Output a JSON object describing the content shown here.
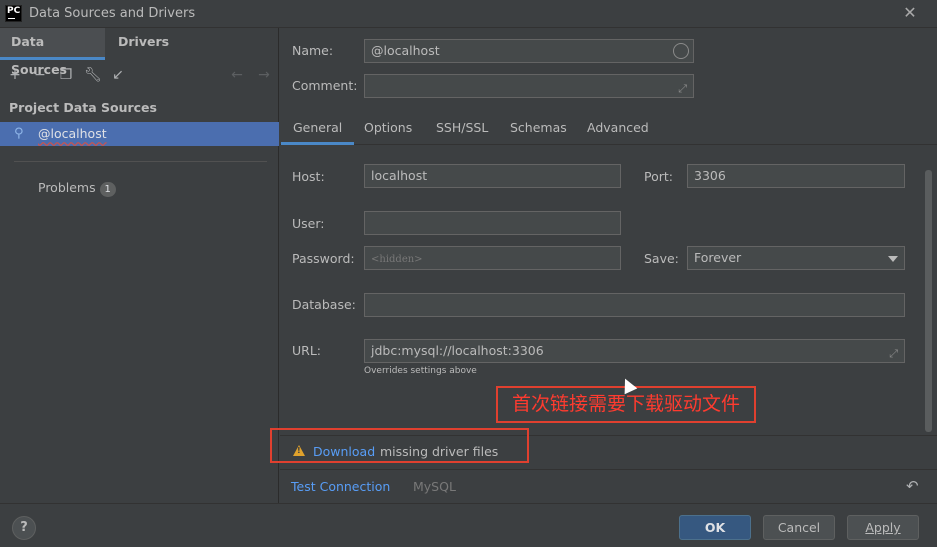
{
  "window": {
    "title": "Data Sources and Drivers",
    "app_logo": "PC"
  },
  "left": {
    "tabs": [
      {
        "label": "Data Sources"
      },
      {
        "label": "Drivers"
      }
    ],
    "toolbar": [
      "add-icon",
      "remove-icon",
      "duplicate-icon",
      "settings-wrench-icon",
      "import-icon",
      "back-arrow-icon",
      "forward-arrow-icon"
    ],
    "section_title": "Project Data Sources",
    "data_sources": [
      {
        "label": "@localhost"
      }
    ],
    "problems": {
      "label": "Problems",
      "count": "1"
    }
  },
  "form": {
    "name": {
      "label": "Name:",
      "value": "@localhost"
    },
    "comment": {
      "label": "Comment:",
      "value": ""
    },
    "tabs": [
      {
        "label": "General"
      },
      {
        "label": "Options"
      },
      {
        "label": "SSH/SSL"
      },
      {
        "label": "Schemas"
      },
      {
        "label": "Advanced"
      }
    ],
    "host": {
      "label": "Host:",
      "value": "localhost"
    },
    "port": {
      "label": "Port:",
      "value": "3306"
    },
    "user": {
      "label": "User:",
      "value": ""
    },
    "password": {
      "label": "Password:",
      "placeholder": "<hidden>"
    },
    "save": {
      "label": "Save:",
      "value": "Forever"
    },
    "database": {
      "label": "Database:",
      "value": ""
    },
    "url": {
      "label": "URL:",
      "value": "jdbc:mysql://localhost:3306",
      "hint": "Overrides settings above"
    }
  },
  "annotation": {
    "text": "首次链接需要下载驱动文件"
  },
  "warning": {
    "link": "Download",
    "text": "missing driver files"
  },
  "bottom": {
    "test_connection": "Test Connection",
    "driver": "MySQL"
  },
  "footer": {
    "help": "?",
    "ok": "OK",
    "cancel": "Cancel",
    "apply": "Apply"
  }
}
